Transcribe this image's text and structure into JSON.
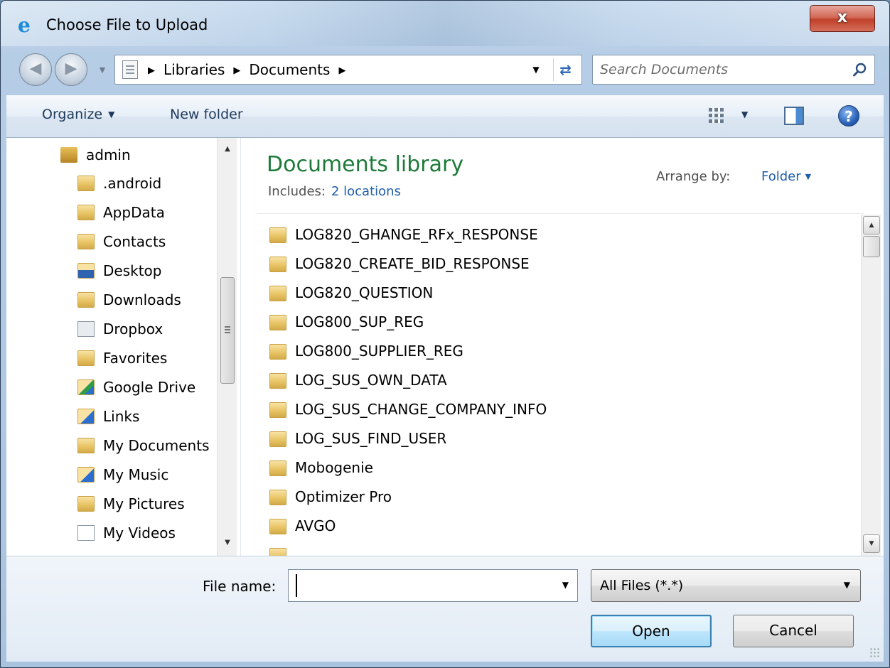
{
  "window": {
    "title": "Choose File to Upload",
    "close_label": "x"
  },
  "address": {
    "crumbs": [
      "Libraries",
      "Documents"
    ],
    "search_placeholder": "Search Documents"
  },
  "toolbar": {
    "organize_label": "Organize",
    "new_folder_label": "New folder"
  },
  "nav": {
    "items": [
      {
        "label": "admin",
        "icon": "user-folder-icon"
      },
      {
        "label": ".android",
        "icon": "folder-icon"
      },
      {
        "label": "AppData",
        "icon": "folder-icon"
      },
      {
        "label": "Contacts",
        "icon": "contacts-folder-icon"
      },
      {
        "label": "Desktop",
        "icon": "desktop-folder-icon"
      },
      {
        "label": "Downloads",
        "icon": "downloads-folder-icon"
      },
      {
        "label": "Dropbox",
        "icon": "dropbox-folder-icon"
      },
      {
        "label": "Favorites",
        "icon": "favorites-folder-icon"
      },
      {
        "label": "Google Drive",
        "icon": "google-drive-folder-icon"
      },
      {
        "label": "Links",
        "icon": "links-folder-icon"
      },
      {
        "label": "My Documents",
        "icon": "documents-folder-icon"
      },
      {
        "label": "My Music",
        "icon": "music-folder-icon"
      },
      {
        "label": "My Pictures",
        "icon": "pictures-folder-icon"
      },
      {
        "label": "My Videos",
        "icon": "videos-file-icon"
      }
    ]
  },
  "library": {
    "title": "Documents library",
    "includes_label": "Includes:",
    "includes_link": "2 locations",
    "arrange_label": "Arrange by:",
    "arrange_value": "Folder"
  },
  "files": [
    "LOG820_GHANGE_RFx_RESPONSE",
    "LOG820_CREATE_BID_RESPONSE",
    "LOG820_QUESTION",
    "LOG800_SUP_REG",
    "LOG800_SUPPLIER_REG",
    "LOG_SUS_OWN_DATA",
    "LOG_SUS_CHANGE_COMPANY_INFO",
    "LOG_SUS_FIND_USER",
    "Mobogenie",
    "Optimizer Pro",
    "AVGO"
  ],
  "bottom": {
    "file_name_label": "File name:",
    "file_name_value": "",
    "file_type_value": "All Files (*.*)",
    "open_label": "Open",
    "cancel_label": "Cancel"
  }
}
